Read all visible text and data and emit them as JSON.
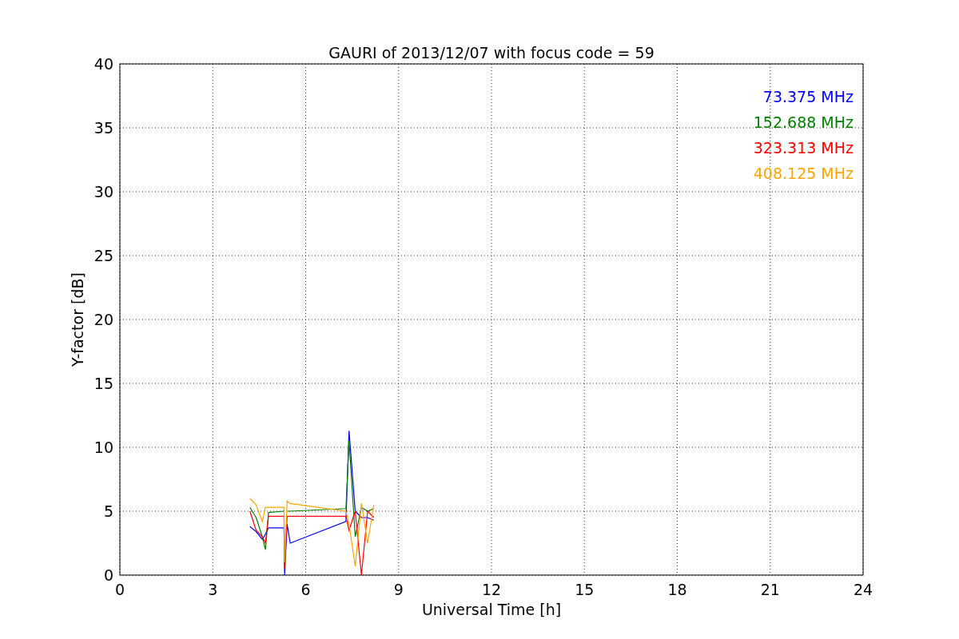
{
  "figure": {
    "chart_data": {
      "type": "line",
      "title": "GAURI of 2013/12/07 with focus code = 59",
      "xlabel": "Universal Time [h]",
      "ylabel": "Y-factor [dB]",
      "x": [
        4.2,
        4.4,
        4.6,
        4.7,
        4.8,
        5.3,
        5.32,
        5.4,
        5.5,
        7.3,
        7.4,
        7.6,
        7.8,
        8.0,
        8.2
      ],
      "series": [
        {
          "name": "73.375 MHz",
          "color": "#0000ff",
          "values": [
            3.8,
            3.4,
            2.8,
            3.2,
            3.7,
            3.7,
            0,
            4.0,
            2.5,
            4.2,
            11.3,
            5.0,
            4.5,
            4.5,
            4.3
          ]
        },
        {
          "name": "152.688 MHz",
          "color": "#008000",
          "values": [
            5.3,
            4.5,
            3.0,
            2.0,
            4.9,
            5.0,
            null,
            5.0,
            5.0,
            5.2,
            10.5,
            3.0,
            5.3,
            5.0,
            5.2
          ]
        },
        {
          "name": "323.313 MHz",
          "color": "#ff0000",
          "values": [
            5.0,
            3.5,
            3.0,
            2.5,
            4.6,
            4.6,
            0.5,
            4.6,
            4.6,
            4.6,
            3.5,
            5.0,
            0,
            5.0,
            4.5
          ]
        },
        {
          "name": "408.125 MHz",
          "color": "#ffa500",
          "values": [
            6.0,
            5.5,
            4.2,
            5.3,
            5.3,
            5.3,
            1.0,
            5.8,
            5.6,
            5.0,
            4.0,
            0.7,
            5.6,
            2.5,
            5.5
          ]
        }
      ],
      "grid": true,
      "xlim": [
        0,
        24
      ],
      "ylim": [
        0,
        40
      ],
      "xticks": [
        0,
        3,
        6,
        9,
        12,
        15,
        18,
        21,
        24
      ],
      "yticks": [
        0,
        5,
        10,
        15,
        20,
        25,
        30,
        35,
        40
      ]
    }
  }
}
